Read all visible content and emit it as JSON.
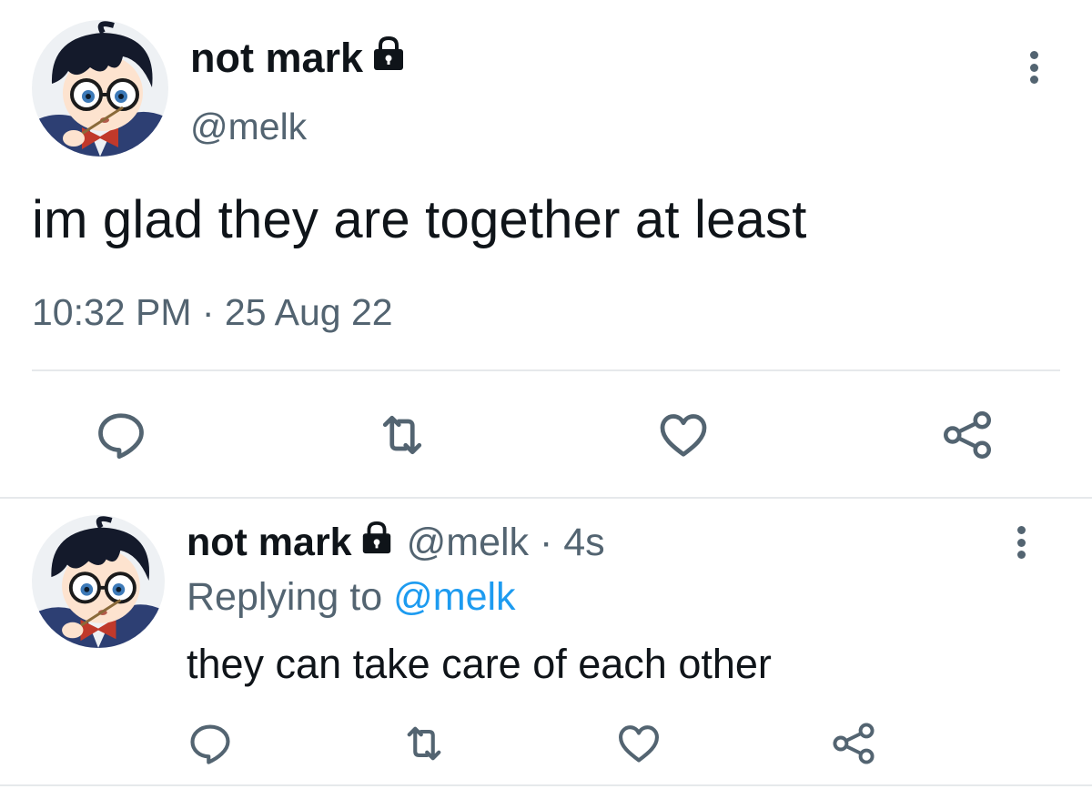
{
  "colors": {
    "text": "#0f1419",
    "secondary": "#536471",
    "link": "#1d9bf0",
    "divider": "#e6e9eb"
  },
  "tweet": {
    "display_name": "not mark",
    "handle": "@melk",
    "text": "im glad they are together at least",
    "timestamp": "10:32 PM · 25 Aug 22",
    "icons": {
      "avatar": "anime-character-avatar",
      "protected": "lock-icon",
      "more": "more-vertical-icon",
      "actions": [
        "reply-icon",
        "retweet-icon",
        "like-icon",
        "share-icon"
      ]
    }
  },
  "reply": {
    "display_name": "not mark",
    "meta": "@melk · 4s",
    "replying_prefix": "Replying to",
    "replying_handle": "@melk",
    "text": "they can take care of each other",
    "icons": {
      "avatar": "anime-character-avatar",
      "protected": "lock-icon",
      "more": "more-vertical-icon",
      "actions": [
        "reply-icon",
        "retweet-icon",
        "like-icon",
        "share-icon"
      ]
    }
  }
}
